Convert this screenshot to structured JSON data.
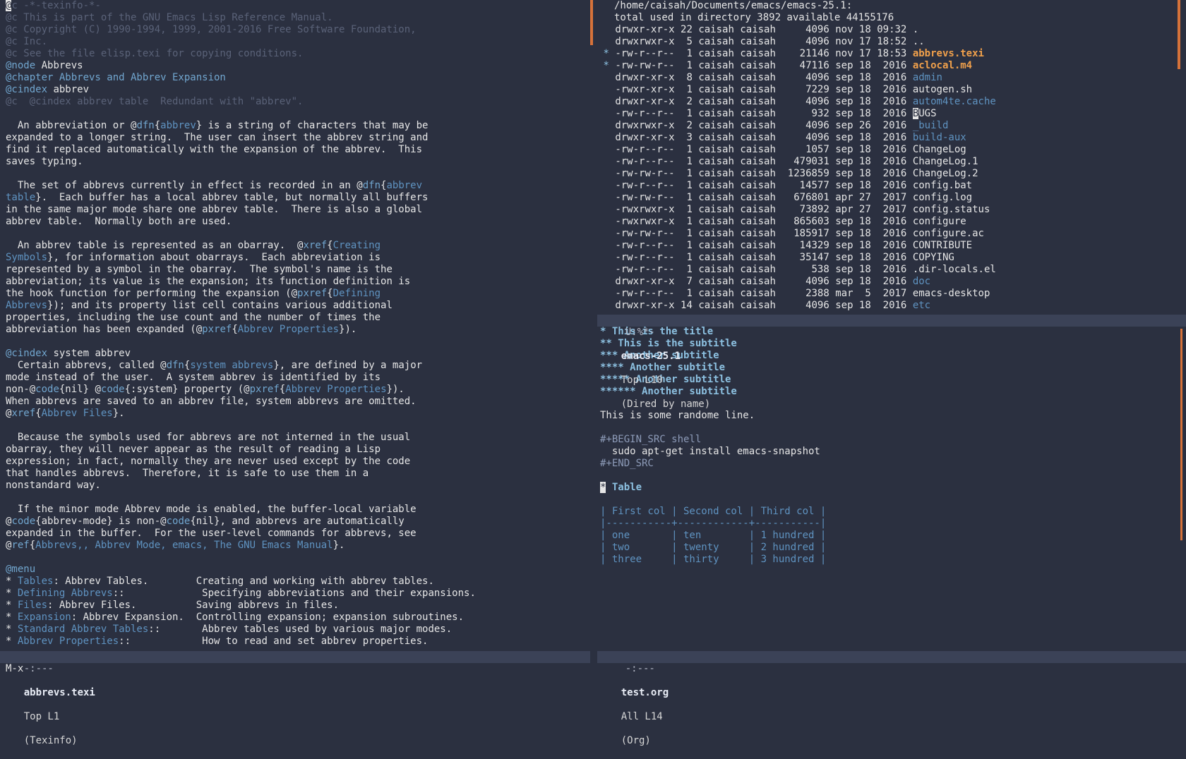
{
  "left_buffer": {
    "lines": [
      [
        {
          "t": "@c -*-texinfo-*-",
          "k": "c-comment"
        }
      ],
      [
        {
          "t": "@c This is part of the GNU Emacs Lisp Reference Manual.",
          "k": "c-comment"
        }
      ],
      [
        {
          "t": "@c Copyright (C) 1990-1994, 1999, 2001-2016 Free Software Foundation,",
          "k": "c-comment"
        }
      ],
      [
        {
          "t": "@c Inc.",
          "k": "c-comment"
        }
      ],
      [
        {
          "t": "@c See the file elisp.texi for copying conditions.",
          "k": "c-comment"
        }
      ],
      [
        {
          "t": "@node",
          "k": "c-key"
        },
        {
          "t": " Abbrevs",
          "k": "c-arg"
        }
      ],
      [
        {
          "t": "@chapter Abbrevs and Abbrev Expansion",
          "k": "c-key"
        }
      ],
      [
        {
          "t": "@cindex",
          "k": "c-key"
        },
        {
          "t": " abbrev",
          "k": "c-arg"
        }
      ],
      [
        {
          "t": "@c  @cindex abbrev table  Redundant with \"abbrev\".",
          "k": "c-comment"
        }
      ],
      [
        {
          "t": "",
          "k": "c-plain"
        }
      ],
      [
        {
          "t": "  An abbreviation or @",
          "k": "c-plain"
        },
        {
          "t": "dfn",
          "k": "c-key"
        },
        {
          "t": "{",
          "k": "c-plain"
        },
        {
          "t": "abbrev",
          "k": "c-link"
        },
        {
          "t": "} is a string of characters that may be",
          "k": "c-plain"
        }
      ],
      [
        {
          "t": "expanded to a longer string.  The user can insert the abbrev string and",
          "k": "c-plain"
        }
      ],
      [
        {
          "t": "find it replaced automatically with the expansion of the abbrev.  This",
          "k": "c-plain"
        }
      ],
      [
        {
          "t": "saves typing.",
          "k": "c-plain"
        }
      ],
      [
        {
          "t": "",
          "k": "c-plain"
        }
      ],
      [
        {
          "t": "  The set of abbrevs currently in effect is recorded in an @",
          "k": "c-plain"
        },
        {
          "t": "dfn",
          "k": "c-key"
        },
        {
          "t": "{",
          "k": "c-plain"
        },
        {
          "t": "abbrev",
          "k": "c-link"
        }
      ],
      [
        {
          "t": "table",
          "k": "c-link"
        },
        {
          "t": "}.  Each buffer has a local abbrev table, but normally all buffers",
          "k": "c-plain"
        }
      ],
      [
        {
          "t": "in the same major mode share one abbrev table.  There is also a global",
          "k": "c-plain"
        }
      ],
      [
        {
          "t": "abbrev table.  Normally both are used.",
          "k": "c-plain"
        }
      ],
      [
        {
          "t": "",
          "k": "c-plain"
        }
      ],
      [
        {
          "t": "  An abbrev table is represented as an obarray.  @",
          "k": "c-plain"
        },
        {
          "t": "xref",
          "k": "c-key"
        },
        {
          "t": "{",
          "k": "c-plain"
        },
        {
          "t": "Creating",
          "k": "c-link"
        }
      ],
      [
        {
          "t": "Symbols",
          "k": "c-link"
        },
        {
          "t": "}, for information about obarrays.  Each abbreviation is",
          "k": "c-plain"
        }
      ],
      [
        {
          "t": "represented by a symbol in the obarray.  The symbol's name is the",
          "k": "c-plain"
        }
      ],
      [
        {
          "t": "abbreviation; its value is the expansion; its function definition is",
          "k": "c-plain"
        }
      ],
      [
        {
          "t": "the hook function for performing the expansion (@",
          "k": "c-plain"
        },
        {
          "t": "pxref",
          "k": "c-key"
        },
        {
          "t": "{",
          "k": "c-plain"
        },
        {
          "t": "Defining",
          "k": "c-link"
        }
      ],
      [
        {
          "t": "Abbrevs",
          "k": "c-link"
        },
        {
          "t": "}); and its property list cell contains various additional",
          "k": "c-plain"
        }
      ],
      [
        {
          "t": "properties, including the use count and the number of times the",
          "k": "c-plain"
        }
      ],
      [
        {
          "t": "abbreviation has been expanded (@",
          "k": "c-plain"
        },
        {
          "t": "pxref",
          "k": "c-key"
        },
        {
          "t": "{",
          "k": "c-plain"
        },
        {
          "t": "Abbrev Properties",
          "k": "c-link"
        },
        {
          "t": "}).",
          "k": "c-plain"
        }
      ],
      [
        {
          "t": "",
          "k": "c-plain"
        }
      ],
      [
        {
          "t": "@cindex",
          "k": "c-key"
        },
        {
          "t": " system abbrev",
          "k": "c-arg"
        }
      ],
      [
        {
          "t": "  Certain abbrevs, called @",
          "k": "c-plain"
        },
        {
          "t": "dfn",
          "k": "c-key"
        },
        {
          "t": "{",
          "k": "c-plain"
        },
        {
          "t": "system abbrevs",
          "k": "c-link"
        },
        {
          "t": "}, are defined by a major",
          "k": "c-plain"
        }
      ],
      [
        {
          "t": "mode instead of the user.  A system abbrev is identified by its",
          "k": "c-plain"
        }
      ],
      [
        {
          "t": "non-@",
          "k": "c-plain"
        },
        {
          "t": "code",
          "k": "c-key"
        },
        {
          "t": "{nil} @",
          "k": "c-plain"
        },
        {
          "t": "code",
          "k": "c-key"
        },
        {
          "t": "{:system} property (@",
          "k": "c-plain"
        },
        {
          "t": "pxref",
          "k": "c-key"
        },
        {
          "t": "{",
          "k": "c-plain"
        },
        {
          "t": "Abbrev Properties",
          "k": "c-link"
        },
        {
          "t": "}).",
          "k": "c-plain"
        }
      ],
      [
        {
          "t": "When abbrevs are saved to an abbrev file, system abbrevs are omitted.",
          "k": "c-plain"
        }
      ],
      [
        {
          "t": "@",
          "k": "c-plain"
        },
        {
          "t": "xref",
          "k": "c-key"
        },
        {
          "t": "{",
          "k": "c-plain"
        },
        {
          "t": "Abbrev Files",
          "k": "c-link"
        },
        {
          "t": "}.",
          "k": "c-plain"
        }
      ],
      [
        {
          "t": "",
          "k": "c-plain"
        }
      ],
      [
        {
          "t": "  Because the symbols used for abbrevs are not interned in the usual",
          "k": "c-plain"
        }
      ],
      [
        {
          "t": "obarray, they will never appear as the result of reading a Lisp",
          "k": "c-plain"
        }
      ],
      [
        {
          "t": "expression; in fact, normally they are never used except by the code",
          "k": "c-plain"
        }
      ],
      [
        {
          "t": "that handles abbrevs.  Therefore, it is safe to use them in a",
          "k": "c-plain"
        }
      ],
      [
        {
          "t": "nonstandard way.",
          "k": "c-plain"
        }
      ],
      [
        {
          "t": "",
          "k": "c-plain"
        }
      ],
      [
        {
          "t": "  If the minor mode Abbrev mode is enabled, the buffer-local variable",
          "k": "c-plain"
        }
      ],
      [
        {
          "t": "@",
          "k": "c-plain"
        },
        {
          "t": "code",
          "k": "c-key"
        },
        {
          "t": "{abbrev-mode} is non-@",
          "k": "c-plain"
        },
        {
          "t": "code",
          "k": "c-key"
        },
        {
          "t": "{nil}, and abbrevs are automatically",
          "k": "c-plain"
        }
      ],
      [
        {
          "t": "expanded in the buffer.  For the user-level commands for abbrevs, see",
          "k": "c-plain"
        }
      ],
      [
        {
          "t": "@",
          "k": "c-plain"
        },
        {
          "t": "ref",
          "k": "c-key"
        },
        {
          "t": "{",
          "k": "c-plain"
        },
        {
          "t": "Abbrevs,, Abbrev Mode, emacs, The GNU Emacs Manual",
          "k": "c-link"
        },
        {
          "t": "}.",
          "k": "c-plain"
        }
      ],
      [
        {
          "t": "",
          "k": "c-plain"
        }
      ],
      [
        {
          "t": "@menu",
          "k": "c-key"
        }
      ],
      [
        {
          "t": "* ",
          "k": "c-plain"
        },
        {
          "t": "Tables",
          "k": "c-link"
        },
        {
          "t": ": Abbrev Tables.        Creating and working with abbrev tables.",
          "k": "c-plain"
        }
      ],
      [
        {
          "t": "* ",
          "k": "c-plain"
        },
        {
          "t": "Defining Abbrevs",
          "k": "c-link"
        },
        {
          "t": "::             Specifying abbreviations and their expansions.",
          "k": "c-plain"
        }
      ],
      [
        {
          "t": "* ",
          "k": "c-plain"
        },
        {
          "t": "Files",
          "k": "c-link"
        },
        {
          "t": ": Abbrev Files.          Saving abbrevs in files.",
          "k": "c-plain"
        }
      ],
      [
        {
          "t": "* ",
          "k": "c-plain"
        },
        {
          "t": "Expansion",
          "k": "c-link"
        },
        {
          "t": ": Abbrev Expansion.  Controlling expansion; expansion subroutines.",
          "k": "c-plain"
        }
      ],
      [
        {
          "t": "* ",
          "k": "c-plain"
        },
        {
          "t": "Standard Abbrev Tables",
          "k": "c-link"
        },
        {
          "t": "::       Abbrev tables used by various major modes.",
          "k": "c-plain"
        }
      ],
      [
        {
          "t": "* ",
          "k": "c-plain"
        },
        {
          "t": "Abbrev Properties",
          "k": "c-link"
        },
        {
          "t": "::            How to read and set abbrev properties.",
          "k": "c-plain"
        }
      ]
    ]
  },
  "dired_buffer": {
    "header": "/home/caisah/Documents/emacs/emacs-25.1:",
    "total": "total used in directory 3892 available 44155176",
    "entries": [
      {
        "mark": " ",
        "perm": "drwxr-xr-x",
        "links": "22",
        "user": "caisah",
        "group": "caisah",
        "size": "4096",
        "date": "nov 18 09:32",
        "name": ".",
        "kind": "file"
      },
      {
        "mark": " ",
        "perm": "drwxrwxr-x",
        "links": " 5",
        "user": "caisah",
        "group": "caisah",
        "size": "4096",
        "date": "nov 17 18:52",
        "name": "..",
        "kind": "file"
      },
      {
        "mark": "*",
        "perm": "-rw-r--r--",
        "links": " 1",
        "user": "caisah",
        "group": "caisah",
        "size": "21146",
        "date": "nov 17 18:53",
        "name": "abbrevs.texi",
        "kind": "marked"
      },
      {
        "mark": "*",
        "perm": "-rw-rw-r--",
        "links": " 1",
        "user": "caisah",
        "group": "caisah",
        "size": "47116",
        "date": "sep 18  2016",
        "name": "aclocal.m4",
        "kind": "marked"
      },
      {
        "mark": " ",
        "perm": "drwxr-xr-x",
        "links": " 8",
        "user": "caisah",
        "group": "caisah",
        "size": "4096",
        "date": "sep 18  2016",
        "name": "admin",
        "kind": "dir"
      },
      {
        "mark": " ",
        "perm": "-rwxr-xr-x",
        "links": " 1",
        "user": "caisah",
        "group": "caisah",
        "size": "7229",
        "date": "sep 18  2016",
        "name": "autogen.sh",
        "kind": "file"
      },
      {
        "mark": " ",
        "perm": "drwxr-xr-x",
        "links": " 2",
        "user": "caisah",
        "group": "caisah",
        "size": "4096",
        "date": "sep 18  2016",
        "name": "autom4te.cache",
        "kind": "dir"
      },
      {
        "mark": " ",
        "perm": "-rw-r--r--",
        "links": " 1",
        "user": "caisah",
        "group": "caisah",
        "size": "932",
        "date": "sep 18  2016",
        "name": "BUGS",
        "kind": "cursor"
      },
      {
        "mark": " ",
        "perm": "drwxrwxr-x",
        "links": " 2",
        "user": "caisah",
        "group": "caisah",
        "size": "4096",
        "date": "sep 26  2016",
        "name": "_build",
        "kind": "dir"
      },
      {
        "mark": " ",
        "perm": "drwxr-xr-x",
        "links": " 3",
        "user": "caisah",
        "group": "caisah",
        "size": "4096",
        "date": "sep 18  2016",
        "name": "build-aux",
        "kind": "dir"
      },
      {
        "mark": " ",
        "perm": "-rw-r--r--",
        "links": " 1",
        "user": "caisah",
        "group": "caisah",
        "size": "1057",
        "date": "sep 18  2016",
        "name": "ChangeLog",
        "kind": "file"
      },
      {
        "mark": " ",
        "perm": "-rw-r--r--",
        "links": " 1",
        "user": "caisah",
        "group": "caisah",
        "size": "479031",
        "date": "sep 18  2016",
        "name": "ChangeLog.1",
        "kind": "file"
      },
      {
        "mark": " ",
        "perm": "-rw-rw-r--",
        "links": " 1",
        "user": "caisah",
        "group": "caisah",
        "size": "1236859",
        "date": "sep 18  2016",
        "name": "ChangeLog.2",
        "kind": "file"
      },
      {
        "mark": " ",
        "perm": "-rw-r--r--",
        "links": " 1",
        "user": "caisah",
        "group": "caisah",
        "size": "14577",
        "date": "sep 18  2016",
        "name": "config.bat",
        "kind": "file"
      },
      {
        "mark": " ",
        "perm": "-rw-rw-r--",
        "links": " 1",
        "user": "caisah",
        "group": "caisah",
        "size": "676801",
        "date": "apr 27  2017",
        "name": "config.log",
        "kind": "file"
      },
      {
        "mark": " ",
        "perm": "-rwxrwxr-x",
        "links": " 1",
        "user": "caisah",
        "group": "caisah",
        "size": "73892",
        "date": "apr 27  2017",
        "name": "config.status",
        "kind": "file"
      },
      {
        "mark": " ",
        "perm": "-rwxrwxr-x",
        "links": " 1",
        "user": "caisah",
        "group": "caisah",
        "size": "865603",
        "date": "sep 18  2016",
        "name": "configure",
        "kind": "file"
      },
      {
        "mark": " ",
        "perm": "-rw-rw-r--",
        "links": " 1",
        "user": "caisah",
        "group": "caisah",
        "size": "185917",
        "date": "sep 18  2016",
        "name": "configure.ac",
        "kind": "file"
      },
      {
        "mark": " ",
        "perm": "-rw-r--r--",
        "links": " 1",
        "user": "caisah",
        "group": "caisah",
        "size": "14329",
        "date": "sep 18  2016",
        "name": "CONTRIBUTE",
        "kind": "file"
      },
      {
        "mark": " ",
        "perm": "-rw-r--r--",
        "links": " 1",
        "user": "caisah",
        "group": "caisah",
        "size": "35147",
        "date": "sep 18  2016",
        "name": "COPYING",
        "kind": "file"
      },
      {
        "mark": " ",
        "perm": "-rw-r--r--",
        "links": " 1",
        "user": "caisah",
        "group": "caisah",
        "size": "538",
        "date": "sep 18  2016",
        "name": ".dir-locals.el",
        "kind": "file"
      },
      {
        "mark": " ",
        "perm": "drwxr-xr-x",
        "links": " 7",
        "user": "caisah",
        "group": "caisah",
        "size": "4096",
        "date": "sep 18  2016",
        "name": "doc",
        "kind": "dir"
      },
      {
        "mark": " ",
        "perm": "-rw-r--r--",
        "links": " 1",
        "user": "caisah",
        "group": "caisah",
        "size": "2388",
        "date": "mar  5  2017",
        "name": "emacs-desktop",
        "kind": "file"
      },
      {
        "mark": " ",
        "perm": "drwxr-xr-x",
        "links": "14",
        "user": "caisah",
        "group": "caisah",
        "size": "4096",
        "date": "sep 18  2016",
        "name": "etc",
        "kind": "dir"
      }
    ]
  },
  "org_buffer": {
    "lines": [
      [
        {
          "t": "* This is the title",
          "k": "c-orgh"
        }
      ],
      [
        {
          "t": "** This is the subtitle",
          "k": "c-orgh"
        }
      ],
      [
        {
          "t": "*** Another subtitle",
          "k": "c-orgh"
        }
      ],
      [
        {
          "t": "**** Another subtitle",
          "k": "c-orgh"
        }
      ],
      [
        {
          "t": "***** Another subtitle",
          "k": "c-orgh"
        }
      ],
      [
        {
          "t": "****** Another subtitle",
          "k": "c-orgh"
        }
      ],
      [
        {
          "t": "",
          "k": "c-plain"
        }
      ],
      [
        {
          "t": "This is some randome line.",
          "k": "c-plain"
        }
      ],
      [
        {
          "t": "",
          "k": "c-plain"
        }
      ],
      [
        {
          "t": "#+BEGIN_SRC shell",
          "k": "c-meta"
        }
      ],
      [
        {
          "t": "  sudo apt-get install emacs-snapshot",
          "k": "c-plain"
        }
      ],
      [
        {
          "t": "#+END_SRC",
          "k": "c-meta"
        }
      ],
      [
        {
          "t": "",
          "k": "c-plain"
        }
      ],
      [
        {
          "t": "*",
          "k": "c-cursor"
        },
        {
          "t": " Table",
          "k": "c-orgh"
        }
      ],
      [
        {
          "t": "",
          "k": "c-plain"
        }
      ],
      [
        {
          "t": "| First col | Second col | Third col |",
          "k": "c-table"
        }
      ],
      [
        {
          "t": "|-----------+------------+-----------|",
          "k": "c-table"
        }
      ],
      [
        {
          "t": "| one       | ten        | 1 hundred |",
          "k": "c-table"
        }
      ],
      [
        {
          "t": "| two       | twenty     | 2 hundred |",
          "k": "c-table"
        }
      ],
      [
        {
          "t": "| three     | thirty     | 3 hundred |",
          "k": "c-table"
        }
      ]
    ]
  },
  "modelines": {
    "left": {
      "flags": "-:---",
      "buffer": "abbrevs.texi",
      "pos": "Top L1",
      "mode": "(Texinfo)"
    },
    "dired": {
      "flags": "U:%*-",
      "buffer": "emacs-25.1",
      "pos": "Top L10",
      "mode": "(Dired by name)"
    },
    "org": {
      "flags": "-:---",
      "buffer": "test.org",
      "pos": "All L14",
      "mode": "(Org)"
    }
  },
  "minibuffer": "M-x"
}
